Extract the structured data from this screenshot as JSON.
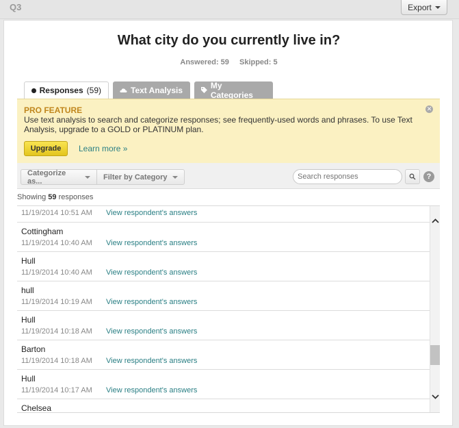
{
  "header": {
    "question_number": "Q3",
    "export_label": "Export"
  },
  "question": {
    "title": "What city do you currently live in?",
    "answered": "Answered: 59",
    "skipped": "Skipped: 5"
  },
  "tabs": [
    {
      "label": "Responses",
      "count": "(59)"
    },
    {
      "label": "Text Analysis"
    },
    {
      "label": "My Categories"
    }
  ],
  "promo": {
    "title": "PRO FEATURE",
    "text": "Use text analysis to search and categorize responses; see frequently-used words and phrases. To use Text Analysis, upgrade to a GOLD or PLATINUM plan.",
    "upgrade_label": "Upgrade",
    "learn_more_label": "Learn more »"
  },
  "toolbar": {
    "categorize_label": "Categorize as...",
    "filter_label": "Filter by Category",
    "search_placeholder": "Search responses"
  },
  "showing": {
    "prefix": "Showing",
    "count": "59",
    "suffix": "responses"
  },
  "responses": [
    {
      "text": "",
      "date": "11/19/2014 10:51 AM",
      "link": "View respondent's answers"
    },
    {
      "text": "Cottingham",
      "date": "11/19/2014 10:40 AM",
      "link": "View respondent's answers"
    },
    {
      "text": "Hull",
      "date": "11/19/2014 10:40 AM",
      "link": "View respondent's answers"
    },
    {
      "text": "hull",
      "date": "11/19/2014 10:19 AM",
      "link": "View respondent's answers"
    },
    {
      "text": "Hull",
      "date": "11/19/2014 10:18 AM",
      "link": "View respondent's answers"
    },
    {
      "text": "Barton",
      "date": "11/19/2014 10:18 AM",
      "link": "View respondent's answers"
    },
    {
      "text": "Hull",
      "date": "11/19/2014 10:17 AM",
      "link": "View respondent's answers"
    },
    {
      "text": "Chelsea",
      "date": "",
      "link": ""
    }
  ],
  "colors": {
    "accent_link": "#2a7f84",
    "promo_title": "#c0861d",
    "promo_bg": "#fbf1c2",
    "upgrade_button": "#f2d53a",
    "inactive_tab": "#a9a9a9"
  },
  "icons": {
    "export_caret": "chevron-down-icon",
    "responses_tab": "speech-bubble-icon",
    "text_analysis_tab": "cloud-icon",
    "my_categories_tab": "tag-icon",
    "close": "close-icon",
    "search": "search-icon",
    "help": "help-icon",
    "scroll_up": "chevron-up-icon",
    "scroll_down": "chevron-down-icon"
  }
}
